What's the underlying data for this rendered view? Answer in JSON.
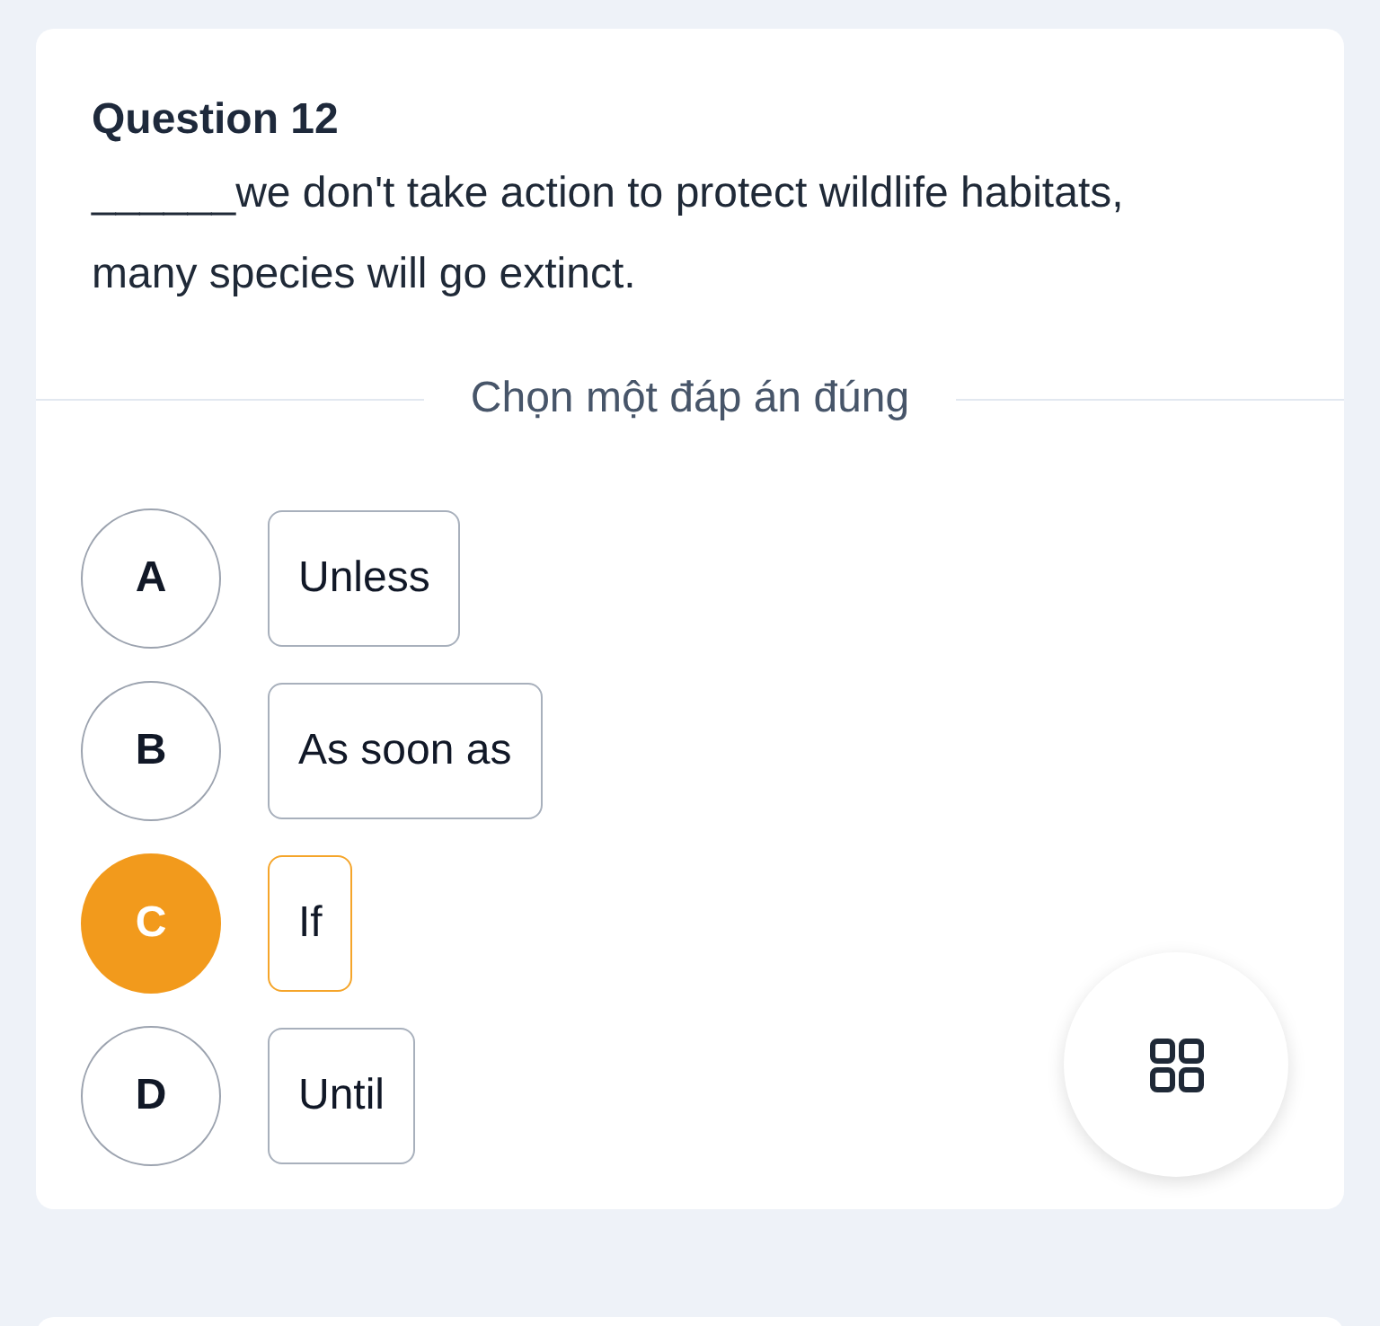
{
  "question": {
    "title": "Question 12",
    "text": "______we don't take action to protect wildlife habitats, many species will go extinct."
  },
  "instruction": "Chọn một đáp án đúng",
  "options": [
    {
      "letter": "A",
      "text": "Unless",
      "selected": false
    },
    {
      "letter": "B",
      "text": "As soon as",
      "selected": false
    },
    {
      "letter": "C",
      "text": "If",
      "selected": true
    },
    {
      "letter": "D",
      "text": "Until",
      "selected": false
    }
  ]
}
